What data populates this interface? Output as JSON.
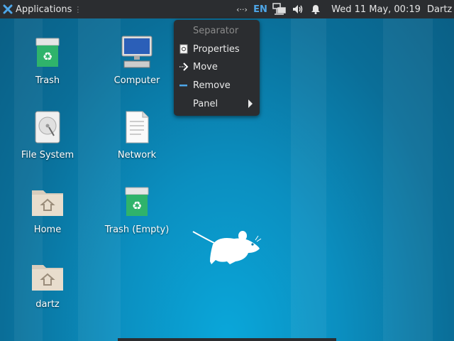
{
  "panel": {
    "applications_label": "Applications",
    "keyboard_text": "‹··›",
    "language": "EN",
    "clock": "Wed 11 May, 00:19",
    "user": "Dartz"
  },
  "context_menu": {
    "title": "Separator",
    "items": [
      {
        "label": "Properties",
        "icon": "properties-icon"
      },
      {
        "label": "Move",
        "icon": "move-icon"
      },
      {
        "label": "Remove",
        "icon": "remove-icon"
      },
      {
        "label": "Panel",
        "icon": "submenu-arrow-icon"
      }
    ]
  },
  "desktop": {
    "icons": [
      {
        "label": "Trash",
        "icon": "trash-icon"
      },
      {
        "label": "Computer",
        "icon": "computer-icon"
      },
      {
        "label": "File System",
        "icon": "harddrive-icon"
      },
      {
        "label": "Network",
        "icon": "network-document-icon"
      },
      {
        "label": "Home",
        "icon": "home-folder-icon"
      },
      {
        "label": "Trash (Empty)",
        "icon": "trash-icon"
      },
      {
        "label": "dartz",
        "icon": "home-folder-icon"
      }
    ]
  },
  "colors": {
    "panel_bg": "#2b2d30",
    "accent_lang": "#4ea6e8",
    "trash_green": "#2fb36b"
  }
}
